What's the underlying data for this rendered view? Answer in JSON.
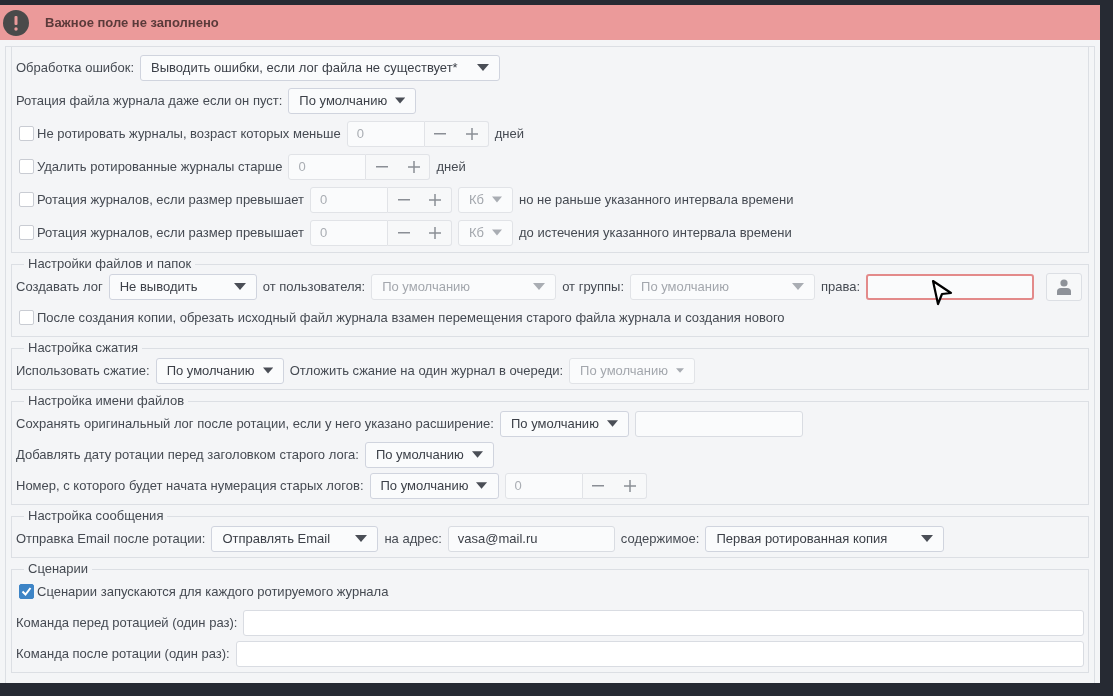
{
  "banner": {
    "message": "Важное поле не заполнено"
  },
  "sections": [
    {
      "lines": [
        {
          "controls": [
            {
              "kind": "label",
              "text": "Обработка ошибок:"
            },
            {
              "kind": "combo",
              "value": "Выводить ошибки, если лог файла не существует*",
              "disabled": false
            }
          ]
        },
        {
          "controls": [
            {
              "kind": "label",
              "text": "Ротация файла журнала даже если он пуст:"
            },
            {
              "kind": "combo",
              "value": "По умолчанию",
              "disabled": false
            }
          ]
        },
        {
          "controls": [
            {
              "kind": "checkbox",
              "text": "Не ротировать журналы, возраст которых меньше",
              "checked": false
            },
            {
              "kind": "spin",
              "value": "0",
              "disabled": true
            },
            {
              "kind": "label",
              "text": "дней"
            }
          ]
        },
        {
          "controls": [
            {
              "kind": "checkbox",
              "text": "Удалить ротированные журналы старше",
              "checked": false
            },
            {
              "kind": "spin",
              "value": "0",
              "disabled": true
            },
            {
              "kind": "label",
              "text": "дней"
            }
          ]
        },
        {
          "controls": [
            {
              "kind": "checkbox",
              "text": "Ротация журналов, если размер превышает",
              "checked": false
            },
            {
              "kind": "spin",
              "value": "0",
              "disabled": true
            },
            {
              "kind": "combo",
              "value": "Кб",
              "disabled": true
            },
            {
              "kind": "label",
              "text": "но не раньше указанного интервала времени"
            }
          ]
        },
        {
          "controls": [
            {
              "kind": "checkbox",
              "text": "Ротация журналов, если размер превышает",
              "checked": false
            },
            {
              "kind": "spin",
              "value": "0",
              "disabled": true
            },
            {
              "kind": "combo",
              "value": "Кб",
              "disabled": true
            },
            {
              "kind": "label",
              "text": "до истечения указанного интервала времени"
            }
          ]
        }
      ]
    },
    {
      "title": "Настройки файлов и папок",
      "lines": [
        {
          "controls": [
            {
              "kind": "label",
              "text": "Создавать лог"
            },
            {
              "kind": "combo",
              "value": "Не выводить",
              "disabled": false
            },
            {
              "kind": "label",
              "text": "от пользователя:"
            },
            {
              "kind": "combo",
              "value": "По умолчанию",
              "disabled": true
            },
            {
              "kind": "label",
              "text": "от группы:"
            },
            {
              "kind": "combo",
              "value": "По умолчанию",
              "disabled": true
            },
            {
              "kind": "label",
              "text": "права:"
            },
            {
              "kind": "field",
              "invalid": true
            },
            {
              "kind": "user-button"
            }
          ]
        },
        {
          "controls": [
            {
              "kind": "checkbox",
              "text": "После создания копии, обрезать исходный файл журнала взамен перемещения старого файла журнала и создания нового",
              "checked": false
            }
          ]
        }
      ]
    },
    {
      "title": "Настройка сжатия",
      "lines": [
        {
          "controls": [
            {
              "kind": "label",
              "text": "Использовать сжатие:"
            },
            {
              "kind": "combo",
              "value": "По умолчанию",
              "disabled": false
            },
            {
              "kind": "label",
              "text": "Отложить сжание на один журнал в очереди:"
            },
            {
              "kind": "combo",
              "value": "По умолчанию",
              "disabled": true
            }
          ]
        }
      ]
    },
    {
      "title": "Настройка имени файлов",
      "lines": [
        {
          "controls": [
            {
              "kind": "label",
              "text": "Сохранять оригинальный лог после ротации, если у него указано расширение:"
            },
            {
              "kind": "combo",
              "value": "По умолчанию",
              "disabled": false
            },
            {
              "kind": "field",
              "invalid": false
            }
          ]
        },
        {
          "controls": [
            {
              "kind": "label",
              "text": "Добавлять дату ротации перед заголовком старого лога:"
            },
            {
              "kind": "combo",
              "value": "По умолчанию",
              "disabled": false
            }
          ]
        },
        {
          "controls": [
            {
              "kind": "label",
              "text": "Номер, с которого будет начата нумерация старых логов:"
            },
            {
              "kind": "combo",
              "value": "По умолчанию",
              "disabled": false
            },
            {
              "kind": "spin",
              "value": "0",
              "disabled": true
            }
          ]
        }
      ]
    },
    {
      "title": "Настройка сообщения",
      "lines": [
        {
          "controls": [
            {
              "kind": "label",
              "text": "Отправка Email после ротации:"
            },
            {
              "kind": "combo",
              "value": "Отправлять Email",
              "disabled": false
            },
            {
              "kind": "label",
              "text": "на адрес:"
            },
            {
              "kind": "field",
              "value": "vasa@mail.ru",
              "invalid": false
            },
            {
              "kind": "label",
              "text": "содержимое:"
            },
            {
              "kind": "combo",
              "value": "Первая ротированная копия",
              "disabled": false
            }
          ]
        }
      ]
    },
    {
      "title": "Сценарии",
      "lines": [
        {
          "controls": [
            {
              "kind": "checkbox",
              "text": "Сценарии запускаются для каждого ротируемого журнала",
              "checked": true
            }
          ]
        },
        {
          "controls": [
            {
              "kind": "label",
              "text": "Команда перед ротацией (один раз):"
            },
            {
              "kind": "wide-field",
              "invalid": false
            }
          ]
        },
        {
          "controls": [
            {
              "kind": "label",
              "text": "Команда после ротации (один раз):"
            },
            {
              "kind": "wide-field",
              "invalid": false
            }
          ]
        }
      ]
    }
  ]
}
